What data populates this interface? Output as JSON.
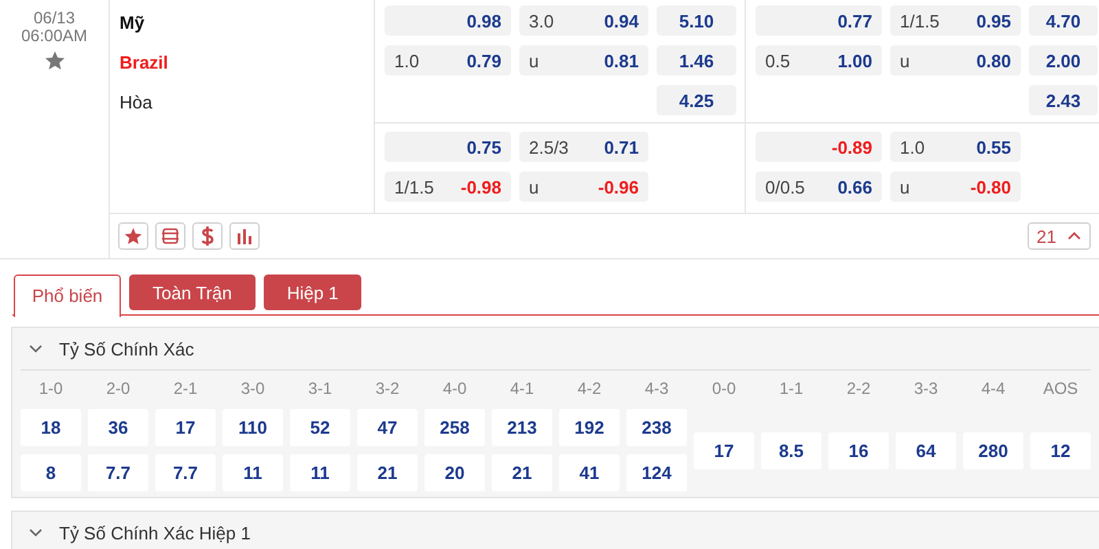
{
  "match": {
    "date": "06/13",
    "time": "06:00AM",
    "teams": [
      {
        "name": "Mỹ",
        "kind": "home"
      },
      {
        "name": "Brazil",
        "kind": "away"
      },
      {
        "name": "Hòa",
        "kind": "draw"
      }
    ],
    "markets": [
      {
        "top": [
          [
            {
              "kind": "odds",
              "odds": "0.98",
              "negative": false
            },
            {
              "kind": "odds",
              "line": "3.0",
              "odds": "0.94",
              "negative": false
            },
            {
              "kind": "odds",
              "odds": "5.10",
              "negative": false
            }
          ],
          [
            {
              "kind": "odds",
              "line": "1.0",
              "odds": "0.79",
              "negative": false
            },
            {
              "kind": "odds",
              "line": "u",
              "odds": "0.81",
              "negative": false
            },
            {
              "kind": "odds",
              "odds": "1.46",
              "negative": false
            }
          ],
          [
            {
              "kind": "gap"
            },
            {
              "kind": "gap"
            },
            {
              "kind": "odds",
              "odds": "4.25",
              "negative": false
            }
          ]
        ],
        "bottom": [
          [
            {
              "kind": "odds",
              "odds": "0.75",
              "negative": false
            },
            {
              "kind": "odds",
              "line": "2.5/3",
              "odds": "0.71",
              "negative": false
            }
          ],
          [
            {
              "kind": "odds",
              "line": "1/1.5",
              "odds": "-0.98",
              "negative": true
            },
            {
              "kind": "odds",
              "line": "u",
              "odds": "-0.96",
              "negative": true
            }
          ]
        ]
      },
      {
        "top": [
          [
            {
              "kind": "odds",
              "odds": "0.77",
              "negative": false
            },
            {
              "kind": "odds",
              "line": "1/1.5",
              "odds": "0.95",
              "negative": false
            },
            {
              "kind": "odds",
              "odds": "4.70",
              "negative": false
            }
          ],
          [
            {
              "kind": "odds",
              "line": "0.5",
              "odds": "1.00",
              "negative": false
            },
            {
              "kind": "odds",
              "line": "u",
              "odds": "0.80",
              "negative": false
            },
            {
              "kind": "odds",
              "odds": "2.00",
              "negative": false
            }
          ],
          [
            {
              "kind": "gap"
            },
            {
              "kind": "gap"
            },
            {
              "kind": "odds",
              "odds": "2.43",
              "negative": false
            }
          ]
        ],
        "bottom": [
          [
            {
              "kind": "odds",
              "odds": "-0.89",
              "negative": true
            },
            {
              "kind": "odds",
              "line": "1.0",
              "odds": "0.55",
              "negative": false
            }
          ],
          [
            {
              "kind": "odds",
              "line": "0/0.5",
              "odds": "0.66",
              "negative": false
            },
            {
              "kind": "odds",
              "line": "u",
              "odds": "-0.80",
              "negative": true
            }
          ]
        ]
      }
    ],
    "more_count": "21"
  },
  "tabs": [
    {
      "label": "Phổ biến",
      "selected": true
    },
    {
      "label": "Toàn Trận",
      "selected": false
    },
    {
      "label": "Hiệp 1",
      "selected": false
    }
  ],
  "sections": [
    {
      "title": "Tỷ Số Chính Xác",
      "scores": [
        {
          "label": "1-0",
          "values": [
            "18",
            "8"
          ]
        },
        {
          "label": "2-0",
          "values": [
            "36",
            "7.7"
          ]
        },
        {
          "label": "2-1",
          "values": [
            "17",
            "7.7"
          ]
        },
        {
          "label": "3-0",
          "values": [
            "110",
            "11"
          ]
        },
        {
          "label": "3-1",
          "values": [
            "52",
            "11"
          ]
        },
        {
          "label": "3-2",
          "values": [
            "47",
            "21"
          ]
        },
        {
          "label": "4-0",
          "values": [
            "258",
            "20"
          ]
        },
        {
          "label": "4-1",
          "values": [
            "213",
            "21"
          ]
        },
        {
          "label": "4-2",
          "values": [
            "192",
            "41"
          ]
        },
        {
          "label": "4-3",
          "values": [
            "238",
            "124"
          ]
        },
        {
          "label": "0-0",
          "values": [
            "17"
          ]
        },
        {
          "label": "1-1",
          "values": [
            "8.5"
          ]
        },
        {
          "label": "2-2",
          "values": [
            "16"
          ]
        },
        {
          "label": "3-3",
          "values": [
            "64"
          ]
        },
        {
          "label": "4-4",
          "values": [
            "280"
          ]
        },
        {
          "label": "AOS",
          "values": [
            "12"
          ]
        }
      ]
    },
    {
      "title": "Tỷ Số Chính Xác Hiệp 1"
    }
  ]
}
